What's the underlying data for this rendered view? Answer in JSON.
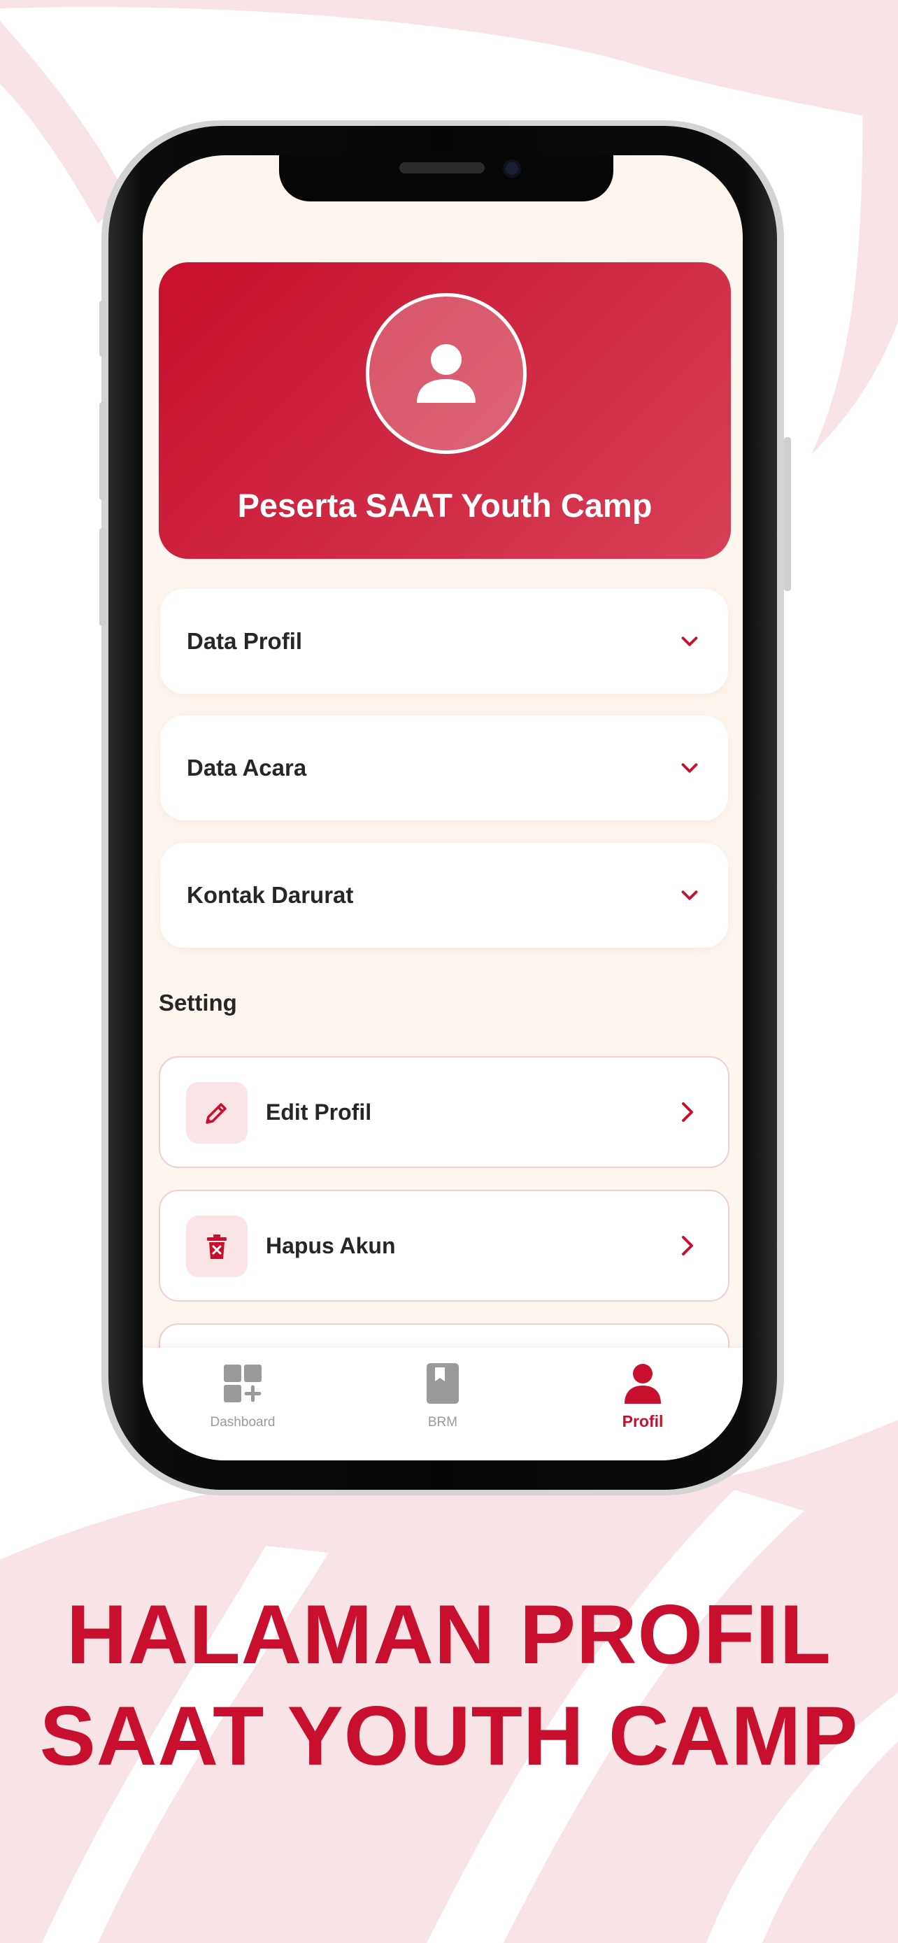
{
  "colors": {
    "accent": "#c8102e",
    "background_blob": "#f8e3e6",
    "screen_bg": "#fdf6ef",
    "icon_tile": "#fbe4e6",
    "nav_inactive": "#9a9a9a"
  },
  "profile": {
    "avatar_icon": "user-avatar-icon",
    "name": "Peserta SAAT Youth Camp"
  },
  "accordions": [
    {
      "label": "Data Profil",
      "icon": "chevron-down-icon"
    },
    {
      "label": "Data Acara",
      "icon": "chevron-down-icon"
    },
    {
      "label": "Kontak Darurat",
      "icon": "chevron-down-icon"
    }
  ],
  "settings": {
    "title": "Setting",
    "items": [
      {
        "label": "Edit Profil",
        "icon": "pencil-icon"
      },
      {
        "label": "Hapus Akun",
        "icon": "trash-icon"
      }
    ]
  },
  "nav": [
    {
      "label": "Dashboard",
      "icon": "dashboard-icon",
      "active": false
    },
    {
      "label": "BRM",
      "icon": "bookmark-book-icon",
      "active": false
    },
    {
      "label": "Profil",
      "icon": "person-icon",
      "active": true
    }
  ],
  "headline": {
    "line1": "HALAMAN PROFIL",
    "line2": "SAAT YOUTH CAMP"
  }
}
